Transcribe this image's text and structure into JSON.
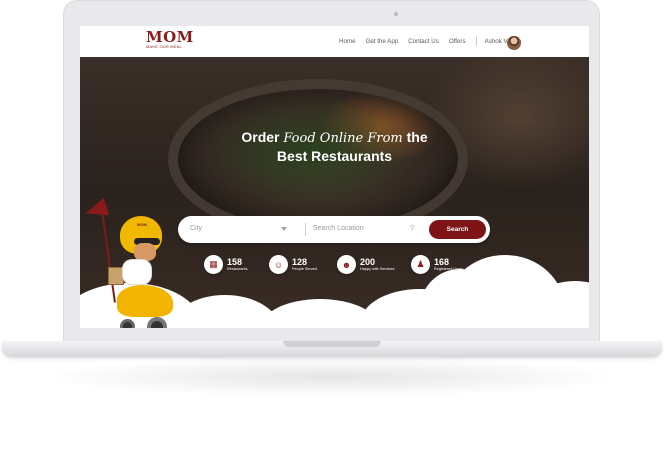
{
  "logo": {
    "text": "MOM",
    "tagline": "MAKE OUR MEAL"
  },
  "nav": {
    "items": [
      "Home",
      "Get the App",
      "Contact Us",
      "Offers"
    ],
    "user_name": "Ashok Verma"
  },
  "hero": {
    "headline_part1": "Order ",
    "headline_script": "Food Online From",
    "headline_part2": " the",
    "headline_line2": "Best Restaurants"
  },
  "search": {
    "city_placeholder": "City",
    "location_placeholder": "Search Location",
    "button_label": "Search"
  },
  "mascot": {
    "helmet_text": "MOM"
  },
  "stats": [
    {
      "value": "158",
      "label": "Restaurants",
      "icon": "storefront-icon"
    },
    {
      "value": "128",
      "label": "People Served",
      "icon": "people-icon"
    },
    {
      "value": "200",
      "label": "Happy with Services",
      "icon": "happy-user-icon"
    },
    {
      "value": "168",
      "label": "Registered Users",
      "icon": "users-icon"
    }
  ],
  "colors": {
    "brand": "#8b1a1a",
    "button": "#7e1416",
    "mascot_yellow": "#f0b800"
  }
}
